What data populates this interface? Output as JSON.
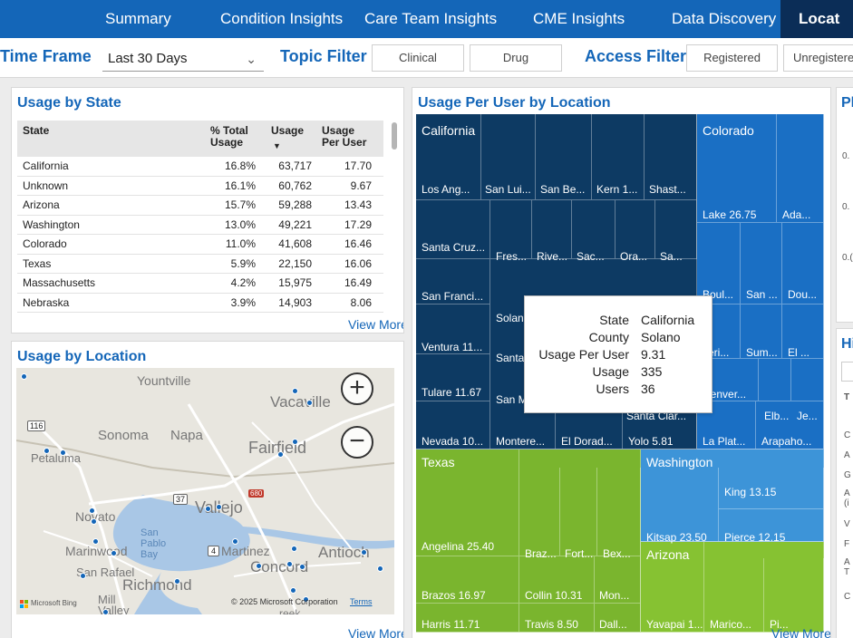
{
  "nav": {
    "tabs": [
      "Summary",
      "Condition Insights",
      "Care Team Insights",
      "CME Insights",
      "Data Discovery",
      "Locat"
    ]
  },
  "filters": {
    "time_frame_label": "Time Frame",
    "time_frame_value": "Last 30 Days",
    "topic_filter_label": "Topic Filter",
    "topic_options": [
      "Clinical",
      "Drug"
    ],
    "access_filter_label": "Access Filter",
    "access_options": [
      "Registered",
      "Unregistere"
    ]
  },
  "usage_by_state": {
    "title": "Usage by State",
    "columns": [
      "State",
      "% Total Usage",
      "Usage",
      "Usage Per User"
    ],
    "rows": [
      [
        "California",
        "16.8%",
        "63,717",
        "17.70"
      ],
      [
        "Unknown",
        "16.1%",
        "60,762",
        "9.67"
      ],
      [
        "Arizona",
        "15.7%",
        "59,288",
        "13.43"
      ],
      [
        "Washington",
        "13.0%",
        "49,221",
        "17.29"
      ],
      [
        "Colorado",
        "11.0%",
        "41,608",
        "16.46"
      ],
      [
        "Texas",
        "5.9%",
        "22,150",
        "16.06"
      ],
      [
        "Massachusetts",
        "4.2%",
        "15,975",
        "16.49"
      ],
      [
        "Nebraska",
        "3.9%",
        "14,903",
        "8.06"
      ]
    ],
    "view_more": "View More"
  },
  "usage_by_location": {
    "title": "Usage by Location",
    "places": [
      "Yountville",
      "Vacaville",
      "Sonoma",
      "Napa",
      "Fairfield",
      "Petaluma",
      "Vallejo",
      "Novato",
      "San Pablo Bay",
      "Marinwood",
      "Martinez",
      "Antioch",
      "Concord",
      "San Rafael",
      "Richmond",
      "Mill Valley",
      "reek"
    ],
    "road_shields": [
      "116",
      "37",
      "680",
      "4"
    ],
    "attribution": "© 2025 Microsoft Corporation",
    "terms": "Terms",
    "provider": "Microsoft Bing",
    "zoom_in": "+",
    "zoom_out": "−",
    "view_more": "View More"
  },
  "usage_per_user": {
    "title": "Usage Per User by Location",
    "state_headers": [
      "California",
      "Colorado",
      "Texas",
      "Washington",
      "Arizona"
    ],
    "counties": [
      "Los Ang...",
      "San Lui...",
      "San Be...",
      "Kern 1...",
      "Shast...",
      "Santa Cruz...",
      "Fres...",
      "Rive...",
      "Sac...",
      "Ora...",
      "Sa...",
      "San Franci...",
      "Solan",
      "Ventura 11...",
      "Santa",
      "Tulare 11.67",
      "San M",
      "Nevada 10...",
      "Montere...",
      "El Dorad...",
      "Yolo 5.81",
      "Santa Clar...",
      "Lake 26.75",
      "Ada...",
      "Boul...",
      "San ...",
      "Dou...",
      "Jeri...",
      "Sum...",
      "El ...",
      "Denver...",
      "Elb...",
      "Je...",
      "La Plat...",
      "Arapaho...",
      "Angelina 25.40",
      "Braz...",
      "Fort...",
      "Bex...",
      "Brazos 16.97",
      "Collin 10.31",
      "Mon...",
      "Harris 11.71",
      "Travis 8.50",
      "Dall...",
      "King 13.15",
      "Kitsap 23.50",
      "Pierce 12.15",
      "Yavapai 1...",
      "Marico...",
      "Pi..."
    ],
    "tooltip": {
      "keys": [
        "State",
        "County",
        "Usage Per User",
        "Usage",
        "Users"
      ],
      "values": [
        "California",
        "Solano",
        "9.31",
        "335",
        "36"
      ]
    },
    "view_more": "View More"
  },
  "right_panel": {
    "title_stub": "Pl",
    "axis_stubs": [
      "0.",
      "0.",
      "0.("
    ],
    "section_stub": "Hi",
    "col_stub": "T",
    "row_stubs": [
      "C",
      "A",
      "G",
      "A (i",
      "V",
      "F",
      "A T",
      "C"
    ]
  },
  "colors": {
    "nav_bg": "#1466b8",
    "nav_active": "#0b2d57",
    "california": "#0d3a63",
    "colorado": "#1a6fc4",
    "texas": "#7ab52e",
    "washington": "#3d94d8",
    "arizona": "#86c232"
  }
}
